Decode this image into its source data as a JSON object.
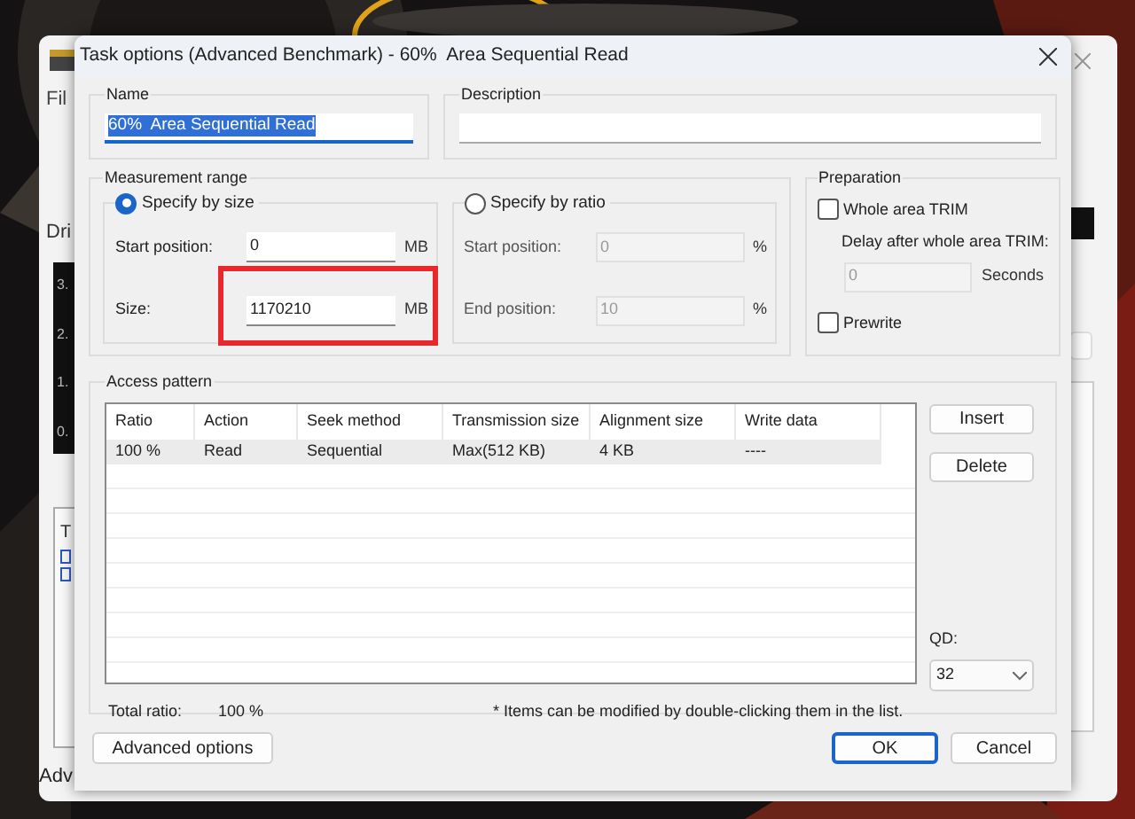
{
  "background_app": {
    "menu": "Fil",
    "section": "Dri",
    "axis": [
      "3.",
      "2.",
      "1.",
      "0."
    ],
    "panel_label": "T",
    "footer": "Adv"
  },
  "window": {
    "title": "Task options (Advanced Benchmark) - 60%  Area Sequential Read"
  },
  "name": {
    "label": "Name",
    "value": "60%  Area Sequential Read",
    "text_selected": true
  },
  "description": {
    "label": "Description"
  },
  "measurement_range": {
    "label": "Measurement range",
    "modes": [
      {
        "label": "Specify by size",
        "selected": true,
        "fields": [
          {
            "label": "Start position:",
            "value": "0",
            "unit": "MB"
          },
          {
            "label": "Size:",
            "value": "1170210",
            "unit": "MB"
          }
        ]
      },
      {
        "label": "Specify by ratio",
        "selected": false,
        "fields": [
          {
            "label": "Start position:",
            "value": "0",
            "unit": "%"
          },
          {
            "label": "End position:",
            "value": "10",
            "unit": "%"
          }
        ]
      }
    ]
  },
  "preparation": {
    "label": "Preparation",
    "whole_area_trim": {
      "label": "Whole area TRIM",
      "checked": false
    },
    "delay_label": "Delay after whole area TRIM:",
    "delay_value": "0",
    "delay_unit": "Seconds",
    "prewrite": {
      "label": "Prewrite",
      "checked": false
    }
  },
  "access_pattern": {
    "label": "Access pattern",
    "columns": [
      "Ratio",
      "Action",
      "Seek method",
      "Transmission size",
      "Alignment size",
      "Write data"
    ],
    "rows": [
      {
        "cells": [
          "100 %",
          "Read",
          "Sequential",
          "Max(512 KB)",
          "4 KB",
          "----"
        ],
        "selected": true
      }
    ],
    "total_label": "Total ratio:",
    "total_value": "100 %",
    "note": "* Items can be modified by double-clicking them in the list.",
    "buttons": [
      "Insert",
      "Delete"
    ],
    "qd_label": "QD:",
    "qd_value": "32"
  },
  "buttons": [
    {
      "label": "Advanced options",
      "default": false
    },
    {
      "label": "OK",
      "default": true
    },
    {
      "label": "Cancel",
      "default": false
    }
  ]
}
